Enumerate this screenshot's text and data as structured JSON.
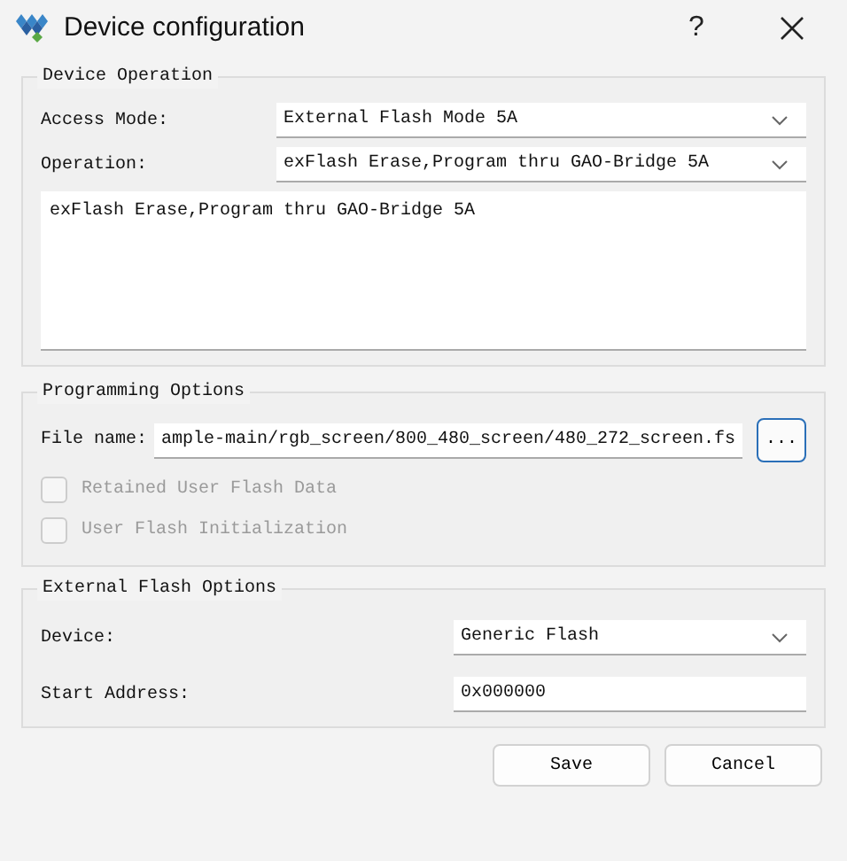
{
  "window": {
    "title": "Device configuration",
    "help": "?"
  },
  "device_operation": {
    "title": "Device Operation",
    "fields": [
      {
        "label": "Access Mode:",
        "kind": "dropdown",
        "value": "External Flash Mode 5A"
      },
      {
        "label": "Operation:",
        "kind": "dropdown",
        "value": "exFlash Erase,Program thru GAO-Bridge 5A"
      }
    ],
    "description": "exFlash Erase,Program thru GAO-Bridge 5A"
  },
  "programming_options": {
    "title": "Programming Options",
    "file": {
      "label": "File name:",
      "value": "ample-main/rgb_screen/800_480_screen/480_272_screen.fs",
      "browse": "..."
    },
    "checkboxes": [
      {
        "label": "Retained User Flash Data",
        "checked": false,
        "disabled": true
      },
      {
        "label": "User Flash Initialization",
        "checked": false,
        "disabled": true
      }
    ]
  },
  "external_flash_options": {
    "title": "External Flash Options",
    "fields": [
      {
        "label": "Device:",
        "kind": "dropdown",
        "value": "Generic Flash"
      },
      {
        "label": "Start Address:",
        "kind": "text",
        "value": "0x000000"
      }
    ]
  },
  "buttons": [
    "Save",
    "Cancel"
  ]
}
